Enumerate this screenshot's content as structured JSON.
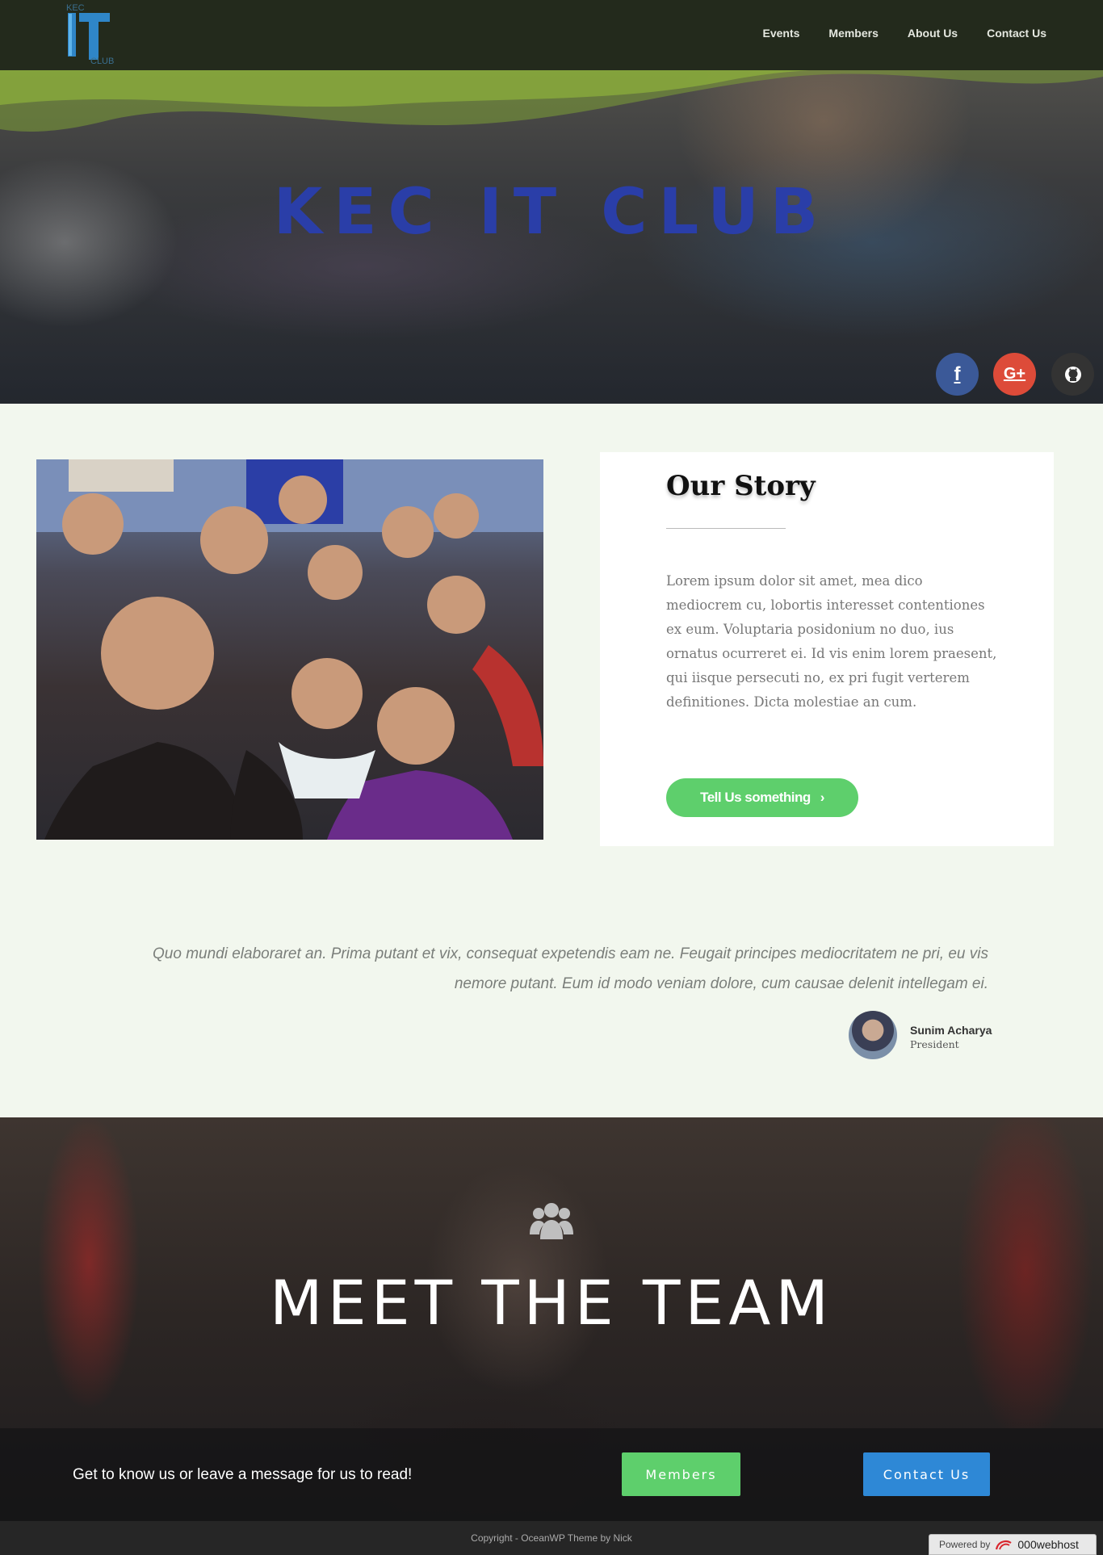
{
  "nav": {
    "logo_kec": "KEC",
    "logo_club": "CLUB",
    "links": [
      "Events",
      "Members",
      "About Us",
      "Contact Us"
    ]
  },
  "hero": {
    "title": "KEC IT CLUB",
    "social": [
      {
        "name": "facebook-icon",
        "glyph": "f",
        "color": "#3b5998"
      },
      {
        "name": "google-plus-icon",
        "glyph": "G+",
        "color": "#dd4b39"
      },
      {
        "name": "github-icon",
        "glyph": "github",
        "color": "#333333"
      }
    ]
  },
  "story": {
    "title": "Our Story",
    "text": "Lorem ipsum dolor sit amet, mea dico mediocrem cu, lobortis interesset contentiones ex eum. Voluptaria posidonium no duo, ius ornatus ocurreret ei. Id vis enim lorem praesent, qui iisque persecuti no, ex pri fugit verterem definitiones. Dicta molestiae an cum.",
    "button_label": "Tell Us something",
    "button_color": "#5ecf6c"
  },
  "testimonial": {
    "quote": "Quo mundi elaboraret an. Prima putant et vix, consequat expetendis eam ne. Feugait principes mediocritatem ne pri, eu vis nemore putant. Eum id modo veniam dolore, cum causae delenit intellegam ei.",
    "author_name": "Sunim Acharya",
    "author_role": "President"
  },
  "team": {
    "title": "MEET THE TEAM",
    "cta_text": "Get to know us or leave a message for us to read!",
    "members_button": "Members",
    "contact_button": "Contact Us",
    "members_color": "#5ecf6c",
    "contact_color": "#2e88d6"
  },
  "footer": {
    "copyright": "Copyright - OceanWP Theme by Nick",
    "badge_powered": "Powered by",
    "badge_brand": "000webhost"
  }
}
